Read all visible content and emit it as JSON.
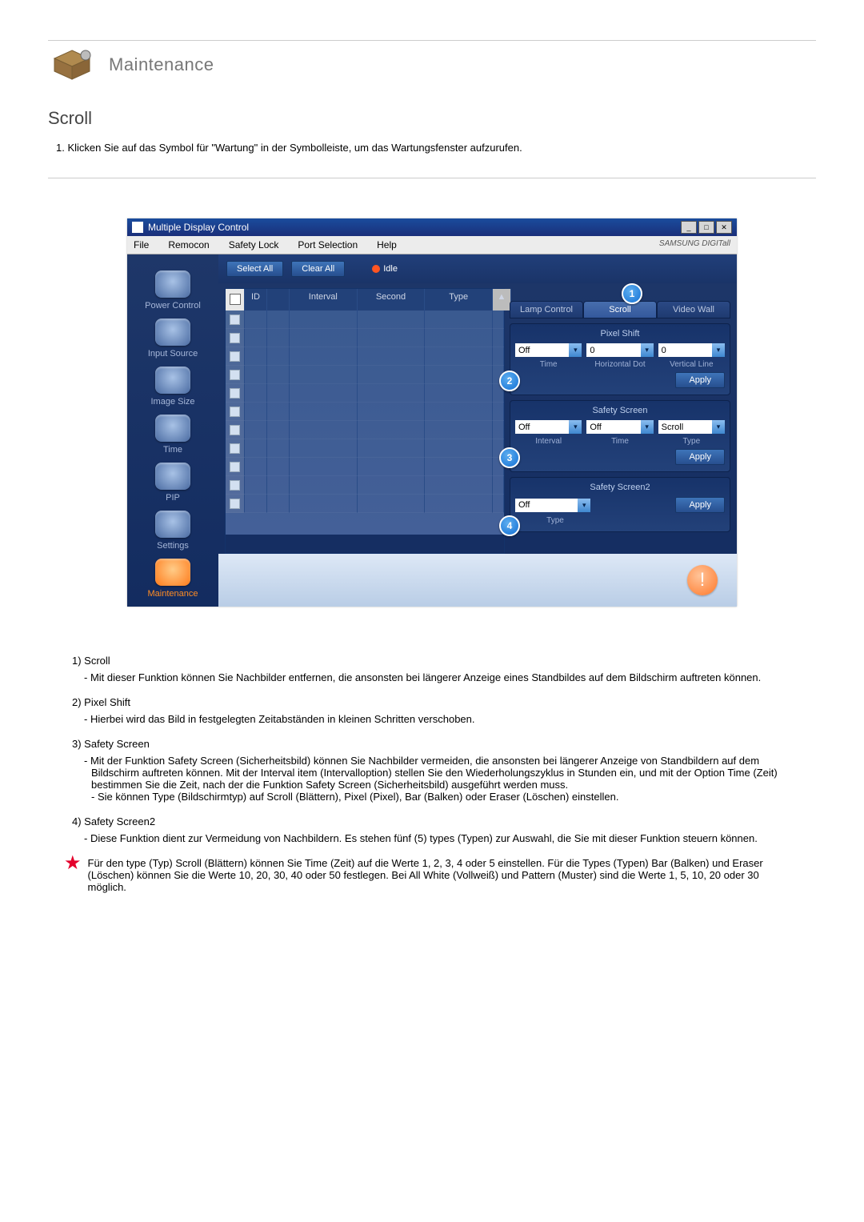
{
  "page": {
    "header_title": "Maintenance",
    "section_title": "Scroll",
    "step_1": "1. Klicken Sie auf das Symbol für \"Wartung\" in der Symbolleiste, um das Wartungsfenster aufzurufen."
  },
  "app": {
    "title": "Multiple Display Control",
    "menubar": [
      "File",
      "Remocon",
      "Safety Lock",
      "Port Selection",
      "Help"
    ],
    "brand": "SAMSUNG DIGITall",
    "sidebar": [
      {
        "label": "Power Control"
      },
      {
        "label": "Input Source"
      },
      {
        "label": "Image Size"
      },
      {
        "label": "Time"
      },
      {
        "label": "PIP"
      },
      {
        "label": "Settings"
      },
      {
        "label": "Maintenance",
        "active": true
      }
    ],
    "toolbar": {
      "select_all": "Select All",
      "clear_all": "Clear All",
      "idle": "Idle"
    },
    "grid": {
      "headers": [
        "ID",
        "",
        "Interval",
        "Second",
        "Type"
      ],
      "row_count": 11
    },
    "tabs": {
      "lamp": "Lamp Control",
      "scroll": "Scroll",
      "videowall": "Video Wall"
    },
    "pixel_shift": {
      "title": "Pixel Shift",
      "value1": "Off",
      "value2": "0",
      "value3": "0",
      "sub1": "Time",
      "sub2": "Horizontal Dot",
      "sub3": "Vertical Line",
      "apply": "Apply"
    },
    "safety_screen": {
      "title": "Safety Screen",
      "value1": "Off",
      "value2": "Off",
      "value3": "Scroll",
      "sub1": "Interval",
      "sub2": "Time",
      "sub3": "Type",
      "apply": "Apply"
    },
    "safety_screen2": {
      "title": "Safety Screen2",
      "value1": "Off",
      "sub1": "Type",
      "apply": "Apply"
    },
    "callouts": {
      "c1": "1",
      "c2": "2",
      "c3": "3",
      "c4": "4"
    }
  },
  "descriptions": [
    {
      "num": "1)",
      "label": "Scroll",
      "text": "Mit dieser Funktion können Sie Nachbilder entfernen, die ansonsten bei längerer Anzeige eines Standbildes auf dem Bildschirm auftreten können."
    },
    {
      "num": "2)",
      "label": "Pixel Shift",
      "text": "Hierbei wird das Bild in festgelegten Zeitabständen in kleinen Schritten verschoben."
    },
    {
      "num": "3)",
      "label": "Safety Screen",
      "text": "Mit der Funktion Safety Screen (Sicherheitsbild) können Sie Nachbilder vermeiden, die ansonsten bei längerer Anzeige von Standbildern auf dem Bildschirm auftreten können.  Mit der Interval item (Intervalloption) stellen Sie den Wiederholungszyklus in Stunden ein, und mit der Option Time (Zeit) bestimmen Sie die Zeit, nach der die Funktion Safety Screen (Sicherheitsbild) ausgeführt werden muss.",
      "text2": "Sie können Type (Bildschirmtyp) auf Scroll (Blättern), Pixel (Pixel), Bar (Balken) oder Eraser (Löschen) einstellen."
    },
    {
      "num": "4)",
      "label": "Safety Screen2",
      "text": "Diese Funktion dient zur Vermeidung von Nachbildern. Es stehen fünf (5) types (Typen) zur Auswahl, die Sie mit dieser Funktion steuern können."
    }
  ],
  "note": "Für den type (Typ) Scroll (Blättern) können Sie Time (Zeit) auf die Werte 1, 2, 3, 4 oder 5 einstellen. Für die Types (Typen) Bar (Balken) und Eraser (Löschen) können Sie die Werte 10, 20, 30, 40 oder 50 festlegen. Bei All White (Vollweiß) und Pattern (Muster) sind die Werte 1, 5, 10, 20 oder 30 möglich."
}
